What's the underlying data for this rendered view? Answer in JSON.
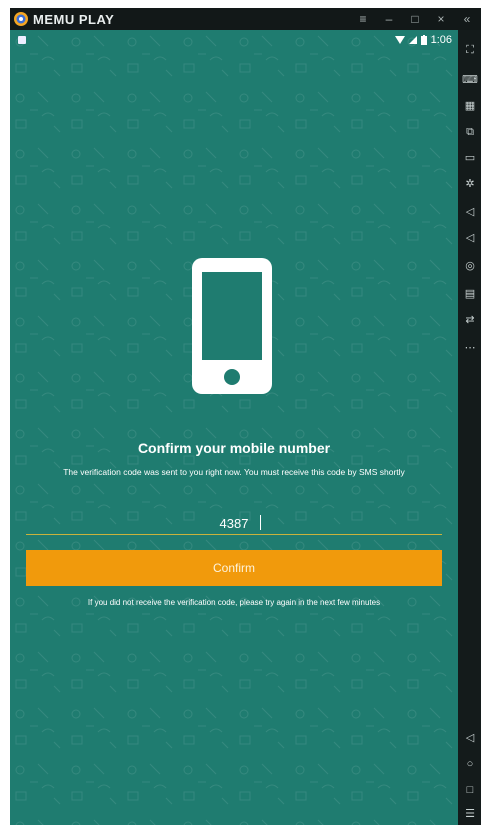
{
  "titlebar": {
    "brand": "MEMU PLAY",
    "controls": {
      "menu": "≡",
      "minimize": "–",
      "maximize": "□",
      "close": "×",
      "collapse": "«"
    }
  },
  "statusbar": {
    "time": "1:06"
  },
  "verification": {
    "title": "Confirm your mobile number",
    "description": "The verification code was sent to you right now. You must receive this code by SMS shortly",
    "code_value": "4387",
    "confirm_label": "Confirm",
    "hint": "If you did not receive the verification code, please try again in the next few minutes"
  },
  "colors": {
    "background": "#1f7c70",
    "button": "#f19a0c",
    "underline": "#c9b23c"
  },
  "sidebar": [
    {
      "name": "fullscreen-icon",
      "glyph": "⛶"
    },
    {
      "name": "keyboard-icon",
      "glyph": "⌨"
    },
    {
      "name": "scan-icon",
      "glyph": "▦"
    },
    {
      "name": "record-icon",
      "glyph": "⧉"
    },
    {
      "name": "window-icon",
      "glyph": "▭"
    },
    {
      "name": "settings-icon",
      "glyph": "✲"
    },
    {
      "name": "volume-up-icon",
      "glyph": "◁"
    },
    {
      "name": "volume-down-icon",
      "glyph": "◁"
    },
    {
      "name": "location-icon",
      "glyph": "◎"
    },
    {
      "name": "folder-icon",
      "glyph": "▤"
    },
    {
      "name": "rotate-icon",
      "glyph": "⇄"
    },
    {
      "name": "more-icon",
      "glyph": "⋯"
    },
    {
      "name": "back-icon",
      "glyph": "◁"
    },
    {
      "name": "home-icon",
      "glyph": "○"
    },
    {
      "name": "recents-icon",
      "glyph": "□"
    },
    {
      "name": "menu-icon",
      "glyph": "☰"
    }
  ]
}
